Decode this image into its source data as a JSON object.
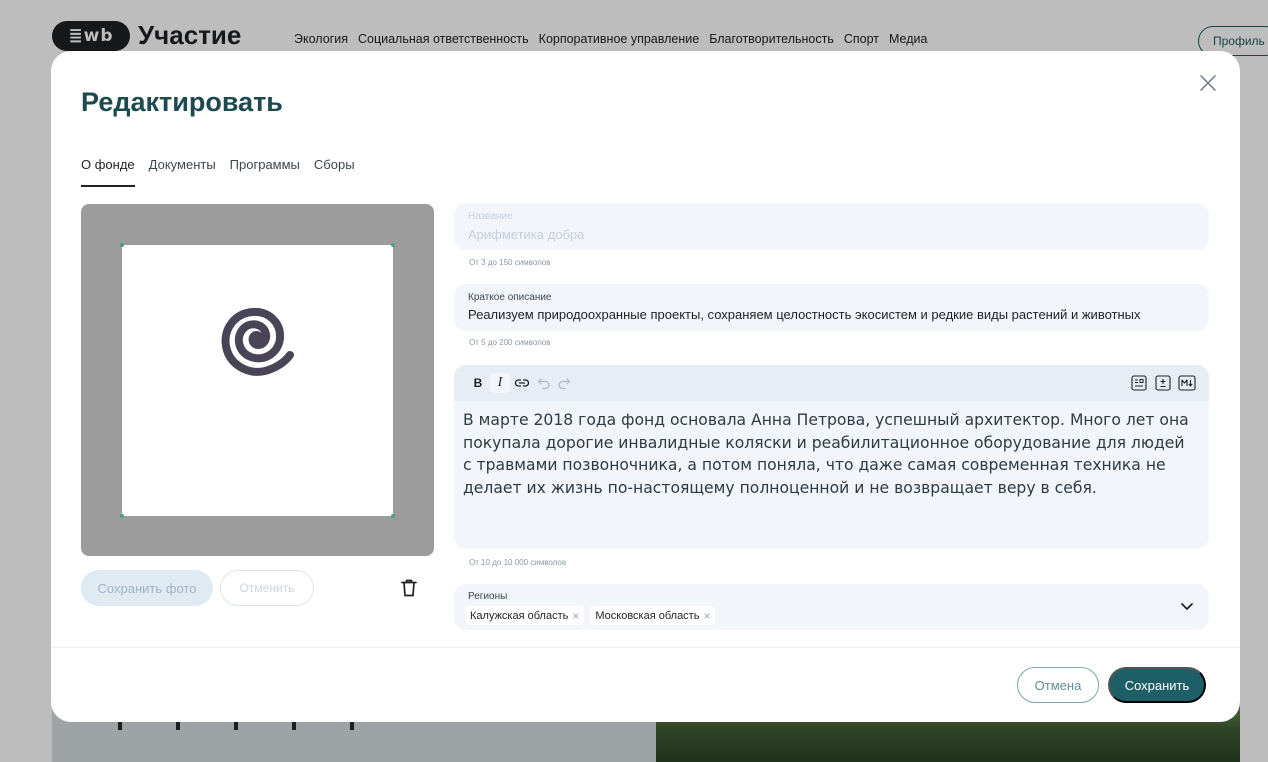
{
  "site": {
    "logo_badge": "≣wb",
    "logo_text": "Участие",
    "nav": [
      "Экология",
      "Социальная ответственность",
      "Корпоративное управление",
      "Благотворительность",
      "Спорт",
      "Медиа"
    ],
    "profile_label": "Профиль"
  },
  "modal": {
    "title": "Редактировать",
    "tabs": [
      {
        "label": "О фонде",
        "active": true
      },
      {
        "label": "Документы",
        "active": false
      },
      {
        "label": "Программы",
        "active": false
      },
      {
        "label": "Сборы",
        "active": false
      }
    ],
    "photo": {
      "save_label": "Сохранить фото",
      "cancel_label": "Отменить"
    },
    "name_field": {
      "label": "Название",
      "value": "Арифметика добра",
      "hint": "От 3 до 150 символов"
    },
    "short_description": {
      "label": "Краткое описание",
      "value": "Реализуем природоохранные проекты, сохраняем целостность экосистем и редкие виды растений и животных",
      "hint": "От 5 до 200 символов"
    },
    "editor": {
      "toolbar": {
        "bold": "B",
        "italic": "I"
      },
      "text": "В марте 2018 года фонд основала Анна Петрова, успешный архитектор. Много лет она покупала дорогие инвалидные коляски и реабилитационное оборудование для людей с травмами позвоночника, а потом поняла, что даже самая современная техника не делает их жизнь по-настоящему полноценной и не возвращает веру в себя.",
      "hint": "От 10 до 10 000 символов"
    },
    "regions": {
      "label": "Регионы",
      "chips": [
        "Калужская область",
        "Московская область"
      ]
    },
    "footer": {
      "cancel_label": "Отмена",
      "save_label": "Сохранить"
    }
  },
  "colors": {
    "accent": "#1e5f67",
    "title": "#1c4a50",
    "field_bg": "#f2f5fa"
  }
}
